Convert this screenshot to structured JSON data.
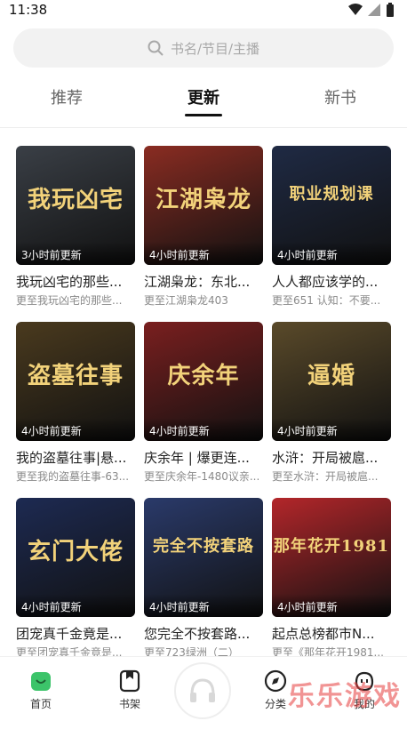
{
  "status": {
    "time": "11:38"
  },
  "search": {
    "placeholder": "书名/节目/主播"
  },
  "tabs": [
    {
      "label": "推荐"
    },
    {
      "label": "更新"
    },
    {
      "label": "新书"
    }
  ],
  "books": [
    {
      "cover_text": "我玩凶宅",
      "badge": "3小时前更新",
      "title": "我玩凶宅的那些...",
      "subtitle": "更至我玩凶宅的那些...",
      "color": "#3a3f46"
    },
    {
      "cover_text": "江湖枭龙",
      "badge": "4小时前更新",
      "title": "江湖枭龙：东北...",
      "subtitle": "更至江湖枭龙403",
      "color": "#8a2c22"
    },
    {
      "cover_text": "职业规划课",
      "badge": "4小时前更新",
      "title": "人人都应该学的...",
      "subtitle": "更至651 认知：不要...",
      "color": "#1f2a44"
    },
    {
      "cover_text": "盗墓往事",
      "badge": "4小时前更新",
      "title": "我的盗墓往事|悬...",
      "subtitle": "更至我的盗墓往事-63...",
      "color": "#4a3a1e"
    },
    {
      "cover_text": "庆余年",
      "badge": "4小时前更新",
      "title": "庆余年 | 爆更连...",
      "subtitle": "更至庆余年-1480议亲...",
      "color": "#7a1f1f"
    },
    {
      "cover_text": "逼婚",
      "badge": "4小时前更新",
      "title": "水浒：开局被扈...",
      "subtitle": "更至水浒：开局被扈...",
      "color": "#5a4a2a"
    },
    {
      "cover_text": "玄门大佬",
      "badge": "4小时前更新",
      "title": "团宠真千金竟是...",
      "subtitle": "更至团宠真千金竟是...",
      "color": "#1d2a52"
    },
    {
      "cover_text": "完全不按套路",
      "badge": "4小时前更新",
      "title": "您完全不按套路...",
      "subtitle": "更至723绿洲（二）",
      "color": "#2a3a6a"
    },
    {
      "cover_text": "那年花开1981",
      "badge": "4小时前更新",
      "title": "起点总榜都市N...",
      "subtitle": "更至《那年花开1981...",
      "color": "#b3262a"
    }
  ],
  "nav": [
    {
      "label": "首页",
      "icon": "home-icon"
    },
    {
      "label": "书架",
      "icon": "bookshelf-icon"
    },
    {
      "label": "分类",
      "icon": "compass-icon"
    },
    {
      "label": "我的",
      "icon": "profile-icon"
    }
  ],
  "watermark": "乐乐游戏"
}
